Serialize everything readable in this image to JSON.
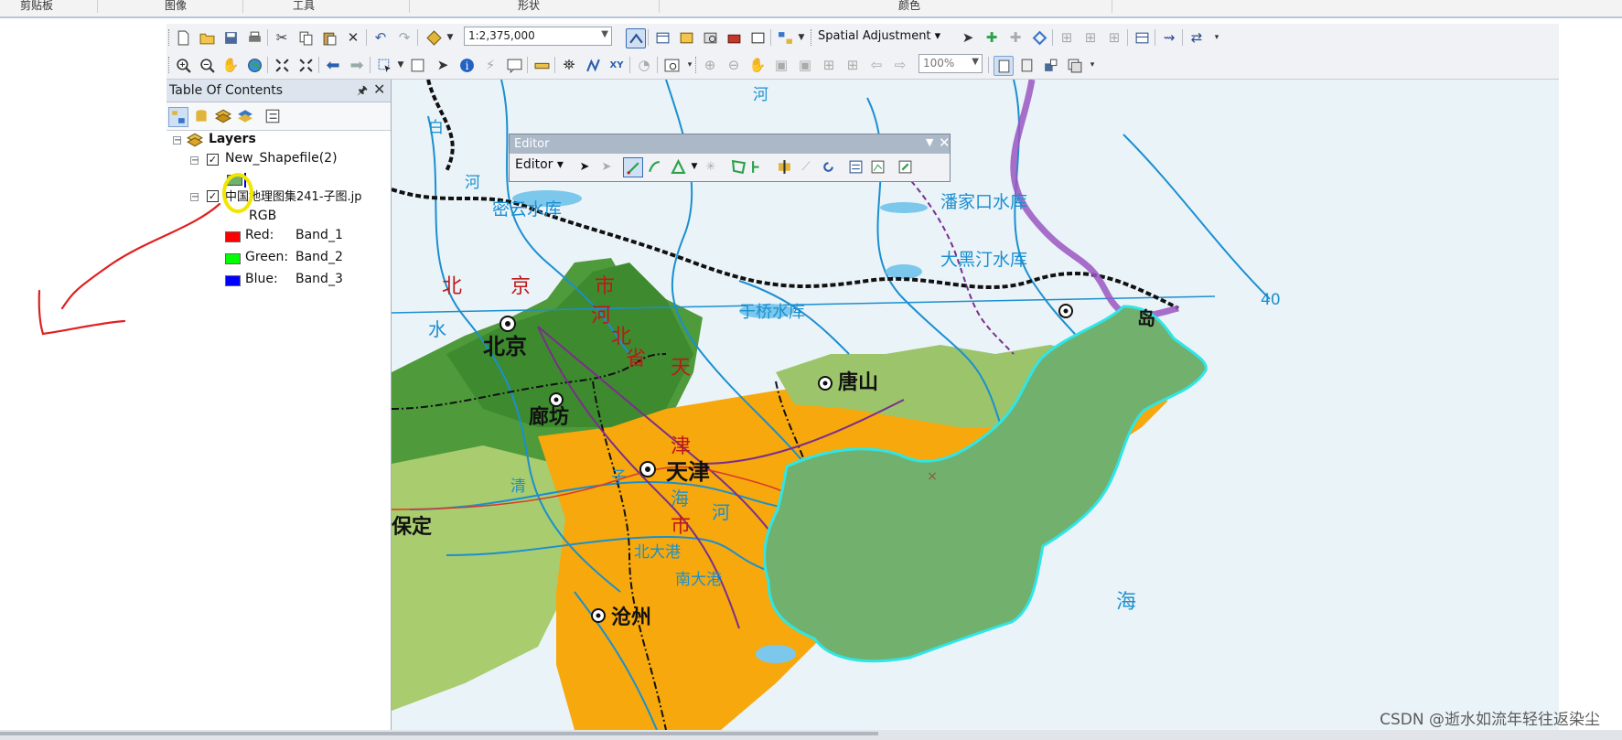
{
  "ribbon": {
    "groups": [
      "剪贴板",
      "图像",
      "工具",
      "形状",
      "颜色"
    ]
  },
  "toolbar": {
    "scale_value": "1:2,375,000",
    "spatial_adjustment_label": "Spatial Adjustment",
    "zoom_value": "100%"
  },
  "toc": {
    "title": "Table Of Contents",
    "pin_icon": "pin-icon",
    "close_icon": "close-icon",
    "root_label": "Layers",
    "layer1_name": "New_Shapefile(2)",
    "layer2_name": "中国地理图集241-子图.jp",
    "rgb_label": "RGB",
    "bands": [
      {
        "label": "Red:",
        "band": "Band_1",
        "color": "#ff0000"
      },
      {
        "label": "Green:",
        "band": "Band_2",
        "color": "#00ff00"
      },
      {
        "label": "Blue:",
        "band": "Band_3",
        "color": "#0000ff"
      }
    ],
    "layer1_symbol_color": "#72b06e"
  },
  "editor": {
    "title": "Editor",
    "dropdown_label": "Editor"
  },
  "map": {
    "place_labels": {
      "beijing_region": "北",
      "jing": "京",
      "shi": "市",
      "he": "河",
      "bei": "北",
      "sheng": "省",
      "tian": "天",
      "jin": "津",
      "shi2": "市",
      "beijing_city": "北京",
      "langfang": "廊坊",
      "tianjin": "天津",
      "tangshan": "唐山",
      "baoding": "保定",
      "cangzhou": "沧州",
      "miyun": "密云水库",
      "panjiakou": "潘家口水库",
      "daheiting": "大黑汀水库",
      "yuqiao": "于桥水库",
      "hai": "海",
      "qinhuangdao_partial": "岛",
      "lat_label": "40",
      "river_bai": "白",
      "river_he1": "河",
      "river_he_top": "河",
      "water_label": "水",
      "haihe": "海",
      "haihe_he": "河",
      "beidagang": "北大港",
      "nandagang": "南大港",
      "ziya": "子",
      "daqing": "清"
    },
    "polygon_fill": "#72b06e",
    "polygon_outline": "#2ee6e6"
  },
  "watermark": "CSDN @逝水如流年轻往返染尘",
  "colors": {
    "plain_orange": "#f6a80d",
    "forest_green": "#4f9a3a",
    "light_green": "#a8cc6e",
    "river_blue": "#1b8fd0",
    "province_purple": "#7a2f8c",
    "annotation_red": "#e02020",
    "highlight_yellow": "#f2e600"
  }
}
